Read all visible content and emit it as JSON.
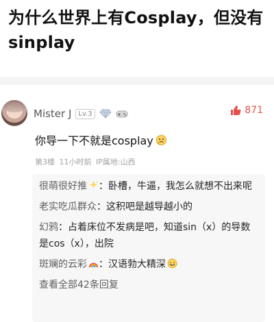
{
  "title": "为什么世界上有Cosplay，但没有sinplay",
  "comment": {
    "username": "Mister J",
    "level": "Lv.3",
    "likes": "871",
    "text": "你导一下不就是cosplay",
    "meta": "第3楼 11小时前 IP属地:山西"
  },
  "replies": [
    {
      "name": "很萌很好推",
      "text": "卧槽，牛逼，我怎么就想不出来呢"
    },
    {
      "name": "老实吃瓜群众",
      "text": "这积吧是越导越小的"
    },
    {
      "name": "幻鸦",
      "text": "占着床位不发病是吧，知道sin（x）的导数是cos（x），出院"
    },
    {
      "name": "斑斓的云彩",
      "text": "汉语勃大精深"
    }
  ],
  "view_all": "查看全部42条回复",
  "icons": {
    "like": "thumbs-up-icon",
    "badge": "diamond-badge-icon",
    "game": "game-controller-icon",
    "thinking": "thinking-face-emoji",
    "sparkles": "sparkles-icon",
    "rainbow": "rainbow-icon",
    "smile": "laughing-face-emoji"
  },
  "colors": {
    "like_red": "#e5514b",
    "username_gray": "#555555",
    "meta_gray": "#a0a0a0",
    "reply_bg": "#f7f7f7"
  }
}
